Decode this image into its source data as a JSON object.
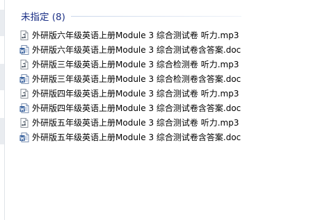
{
  "group": {
    "title": "未指定 (8)"
  },
  "files": [
    {
      "name": "外研版六年级英语上册Module 3 综合测试卷 听力.mp3",
      "icon": "audio-file-icon"
    },
    {
      "name": "外研版六年级英语上册Module 3 综合测试卷含答案.doc",
      "icon": "word-document-icon"
    },
    {
      "name": "外研版三年级英语上册Module 3 综合检测卷 听力.mp3",
      "icon": "audio-file-icon"
    },
    {
      "name": "外研版三年级英语上册Module 3 综合检测卷含答案.doc",
      "icon": "word-document-icon"
    },
    {
      "name": "外研版四年级英语上册Module 3 综合测试卷 听力.mp3",
      "icon": "audio-file-icon"
    },
    {
      "name": "外研版四年级英语上册Module 3 综合测试卷含答案.doc",
      "icon": "word-document-icon"
    },
    {
      "name": "外研版五年级英语上册Module 3 综合测试卷 听力.mp3",
      "icon": "audio-file-icon"
    },
    {
      "name": "外研版五年级英语上册Module 3 综合测试卷含答案.doc",
      "icon": "word-document-icon"
    }
  ],
  "colors": {
    "group_title": "#1e3287",
    "background": "#ffffff",
    "word_icon_blue": "#2b5797",
    "audio_icon_gray": "#6d7580"
  }
}
